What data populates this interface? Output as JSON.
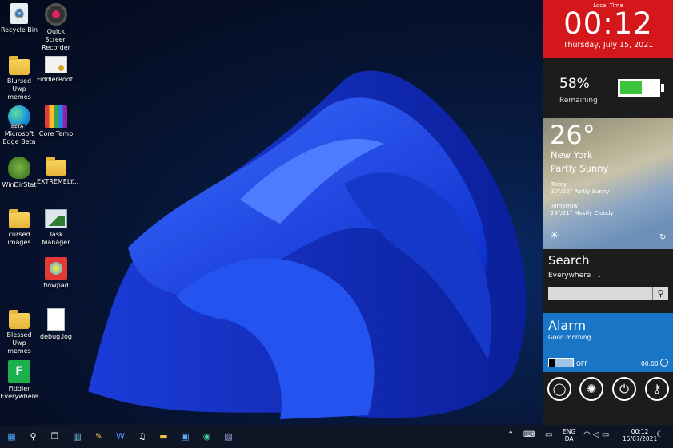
{
  "desktop": {
    "icons": [
      {
        "label": "Recycle Bin"
      },
      {
        "label": "Quick Screen Recorder"
      },
      {
        "label": "Blursed Uwp memes"
      },
      {
        "label": "FiddlerRoot..."
      },
      {
        "label": "Microsoft Edge Beta"
      },
      {
        "label": "Core Temp"
      },
      {
        "label": "WinDirStat"
      },
      {
        "label": "EXTREMELY..."
      },
      {
        "label": "cursed images"
      },
      {
        "label": "Task Manager"
      },
      {
        "label": "flowpad"
      },
      {
        "label": "Blessed Uwp memes"
      },
      {
        "label": "debug.log"
      },
      {
        "label": "Fiddler Everywhere"
      }
    ],
    "edge_badge": "BETA",
    "fiddler_letter": "F"
  },
  "sidebar": {
    "clock": {
      "heading": "Local Time",
      "time": "00:12",
      "date": "Thursday, July 15, 2021"
    },
    "battery": {
      "percent_text": "58%",
      "label": "Remaining",
      "level": 0.58
    },
    "weather": {
      "temp": "26°",
      "city": "New York",
      "condition": "Partly Sunny",
      "today_label": "Today",
      "today_forecast": "30°/22° Partly Sunny",
      "tomorrow_label": "Tomorrow",
      "tomorrow_forecast": "24°/21° Mostly Cloudy"
    },
    "search": {
      "heading": "Search",
      "scope": "Everywhere",
      "value": ""
    },
    "alarm": {
      "heading": "Alarm",
      "message": "Good morning",
      "state": "OFF",
      "time": "00:00"
    }
  },
  "taskbar": {
    "lang_top": "ENG",
    "lang_bottom": "DA",
    "time": "00:12",
    "date": "15/07/2021"
  },
  "colors": {
    "clock_bg": "#d3171b",
    "alarm_bg": "#1976c7",
    "battery_fill": "#3cc43c"
  }
}
